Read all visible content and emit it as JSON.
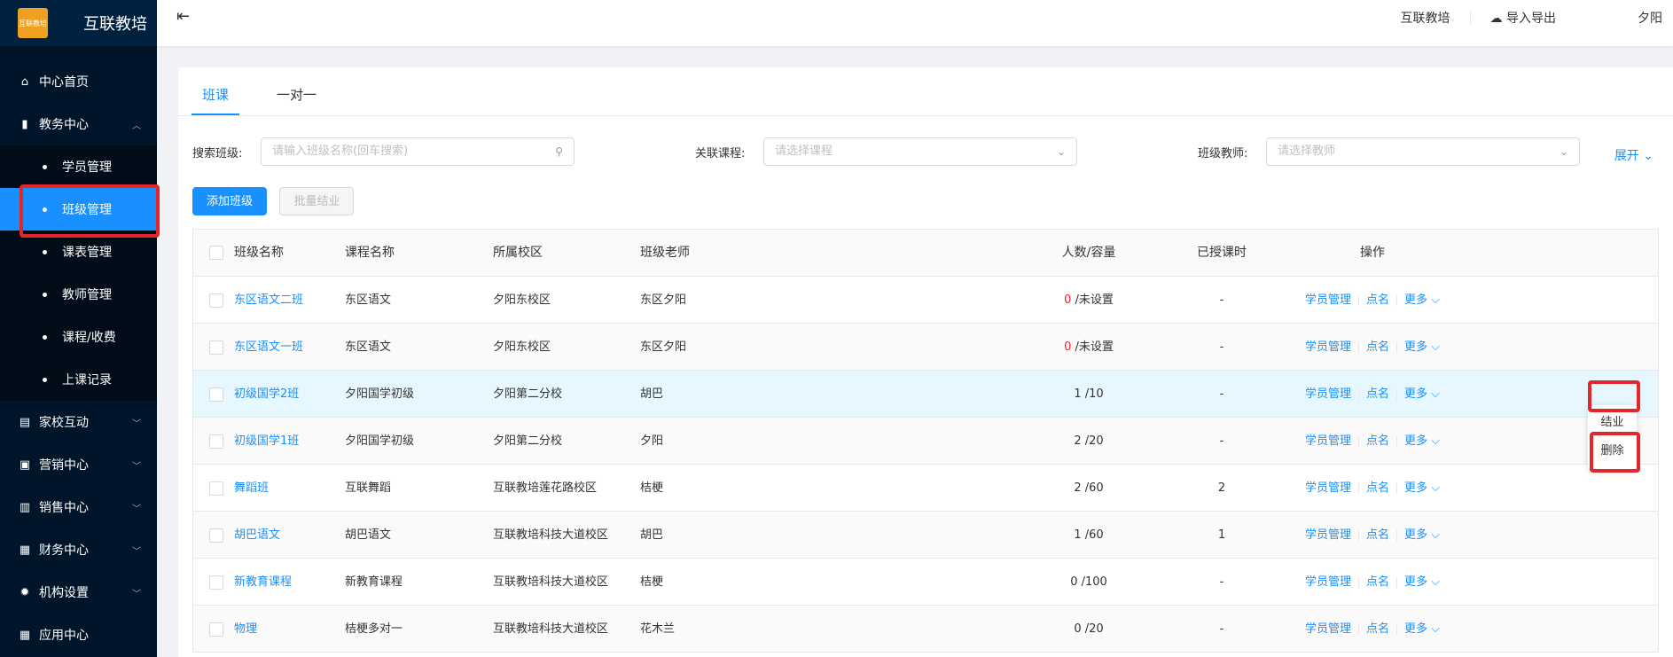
{
  "brand": {
    "logo_text": "互联教培",
    "name": "互联教培"
  },
  "sidebar": {
    "items": [
      {
        "label": "中心首页",
        "icon": "home-icon",
        "expandable": false
      },
      {
        "label": "教务中心",
        "icon": "book-icon",
        "expandable": true,
        "expanded": true,
        "children": [
          {
            "label": "学员管理"
          },
          {
            "label": "班级管理",
            "active": true
          },
          {
            "label": "课表管理"
          },
          {
            "label": "教师管理"
          },
          {
            "label": "课程/收费"
          },
          {
            "label": "上课记录"
          }
        ]
      },
      {
        "label": "家校互动",
        "icon": "chat-icon",
        "expandable": true
      },
      {
        "label": "营销中心",
        "icon": "gift-icon",
        "expandable": true
      },
      {
        "label": "销售中心",
        "icon": "chart-icon",
        "expandable": true
      },
      {
        "label": "财务中心",
        "icon": "wallet-icon",
        "expandable": true
      },
      {
        "label": "机构设置",
        "icon": "gear-icon",
        "expandable": true
      },
      {
        "label": "应用中心",
        "icon": "grid-icon",
        "expandable": false
      }
    ]
  },
  "header": {
    "org": "互联教培",
    "import_export": "导入导出",
    "user": "夕阳"
  },
  "tabs": [
    {
      "label": "班课",
      "active": true
    },
    {
      "label": "一对一"
    }
  ],
  "filters": {
    "search_label": "搜索班级:",
    "search_placeholder": "请输入班级名称(回车搜索)",
    "course_label": "关联课程:",
    "course_placeholder": "请选择课程",
    "teacher_label": "班级教师:",
    "teacher_placeholder": "请选择教师",
    "expand": "展开"
  },
  "buttons": {
    "add": "添加班级",
    "batch": "批量结业"
  },
  "table": {
    "columns": [
      "班级名称",
      "课程名称",
      "所属校区",
      "班级老师",
      "人数/容量",
      "已授课时",
      "操作"
    ],
    "rows": [
      {
        "name": "东区语文二班",
        "course": "东区语文",
        "campus": "夕阳东校区",
        "teacher": "东区夕阳",
        "count": "0",
        "capacity": "/未设置",
        "count_red": true,
        "hours": "-"
      },
      {
        "name": "东区语文一班",
        "course": "东区语文",
        "campus": "夕阳东校区",
        "teacher": "东区夕阳",
        "count": "0",
        "capacity": "/未设置",
        "count_red": true,
        "hours": "-"
      },
      {
        "name": "初级国学2班",
        "course": "夕阳国学初级",
        "campus": "夕阳第二分校",
        "teacher": "胡巴",
        "count": "1",
        "capacity": "/10",
        "count_red": false,
        "hours": "-"
      },
      {
        "name": "初级国学1班",
        "course": "夕阳国学初级",
        "campus": "夕阳第二分校",
        "teacher": "夕阳",
        "count": "2",
        "capacity": "/20",
        "count_red": false,
        "hours": "-"
      },
      {
        "name": "舞蹈班",
        "course": "互联舞蹈",
        "campus": "互联教培莲花路校区",
        "teacher": "桔梗",
        "count": "2",
        "capacity": "/60",
        "count_red": false,
        "hours": "2"
      },
      {
        "name": "胡巴语文",
        "course": "胡巴语文",
        "campus": "互联教培科技大道校区",
        "teacher": "胡巴",
        "count": "1",
        "capacity": "/60",
        "count_red": false,
        "hours": "1"
      },
      {
        "name": "新教育课程",
        "course": "新教育课程",
        "campus": "互联教培科技大道校区",
        "teacher": "桔梗",
        "count": "0",
        "capacity": "/100",
        "count_red": false,
        "hours": "-"
      },
      {
        "name": "物理",
        "course": "桔梗多对一",
        "campus": "互联教培科技大道校区",
        "teacher": "花木兰",
        "count": "0",
        "capacity": "/20",
        "count_red": false,
        "hours": "-"
      }
    ],
    "ops": {
      "students": "学员管理",
      "rollcall": "点名",
      "more": "更多"
    }
  },
  "dropdown": {
    "items": [
      "结业",
      "删除"
    ]
  },
  "colors": {
    "sidebar_bg": "#001529",
    "primary": "#1890ff",
    "highlight_box": "#e3262a"
  }
}
